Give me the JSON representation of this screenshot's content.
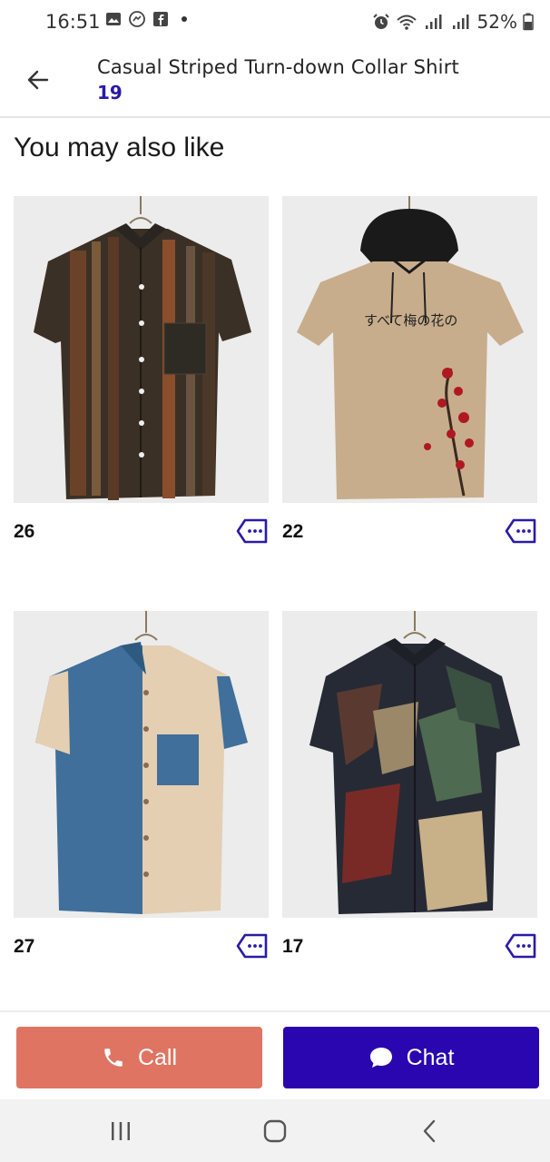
{
  "status_bar": {
    "time": "16:51",
    "battery": "52%",
    "icons": [
      "gallery-icon",
      "messenger-icon",
      "facebook-icon",
      "notification-dot",
      "alarm-icon",
      "wifi-icon",
      "signal-icon",
      "signal-icon",
      "battery-icon"
    ]
  },
  "header": {
    "title": "Casual Striped Turn-down Collar Shirt",
    "count": "19",
    "back_icon": "arrow-left-icon"
  },
  "section": {
    "title": "You may also like"
  },
  "products": [
    {
      "price": "26",
      "image": "striped-tribal-shirt",
      "tag_icon": "tag-icon"
    },
    {
      "price": "22",
      "image": "beige-hooded-tshirt-cherry-blossom",
      "tag_icon": "tag-icon"
    },
    {
      "price": "27",
      "image": "blue-beige-colorblock-shirt",
      "tag_icon": "tag-icon"
    },
    {
      "price": "17",
      "image": "abstract-print-shirt",
      "tag_icon": "tag-icon"
    }
  ],
  "actions": {
    "call_label": "Call",
    "chat_label": "Chat",
    "call_color": "#e07462",
    "chat_color": "#2a06b0"
  },
  "colors": {
    "accent": "#2a1aa8"
  },
  "nav": {
    "items": [
      "recent-apps-icon",
      "home-icon",
      "back-icon"
    ]
  }
}
